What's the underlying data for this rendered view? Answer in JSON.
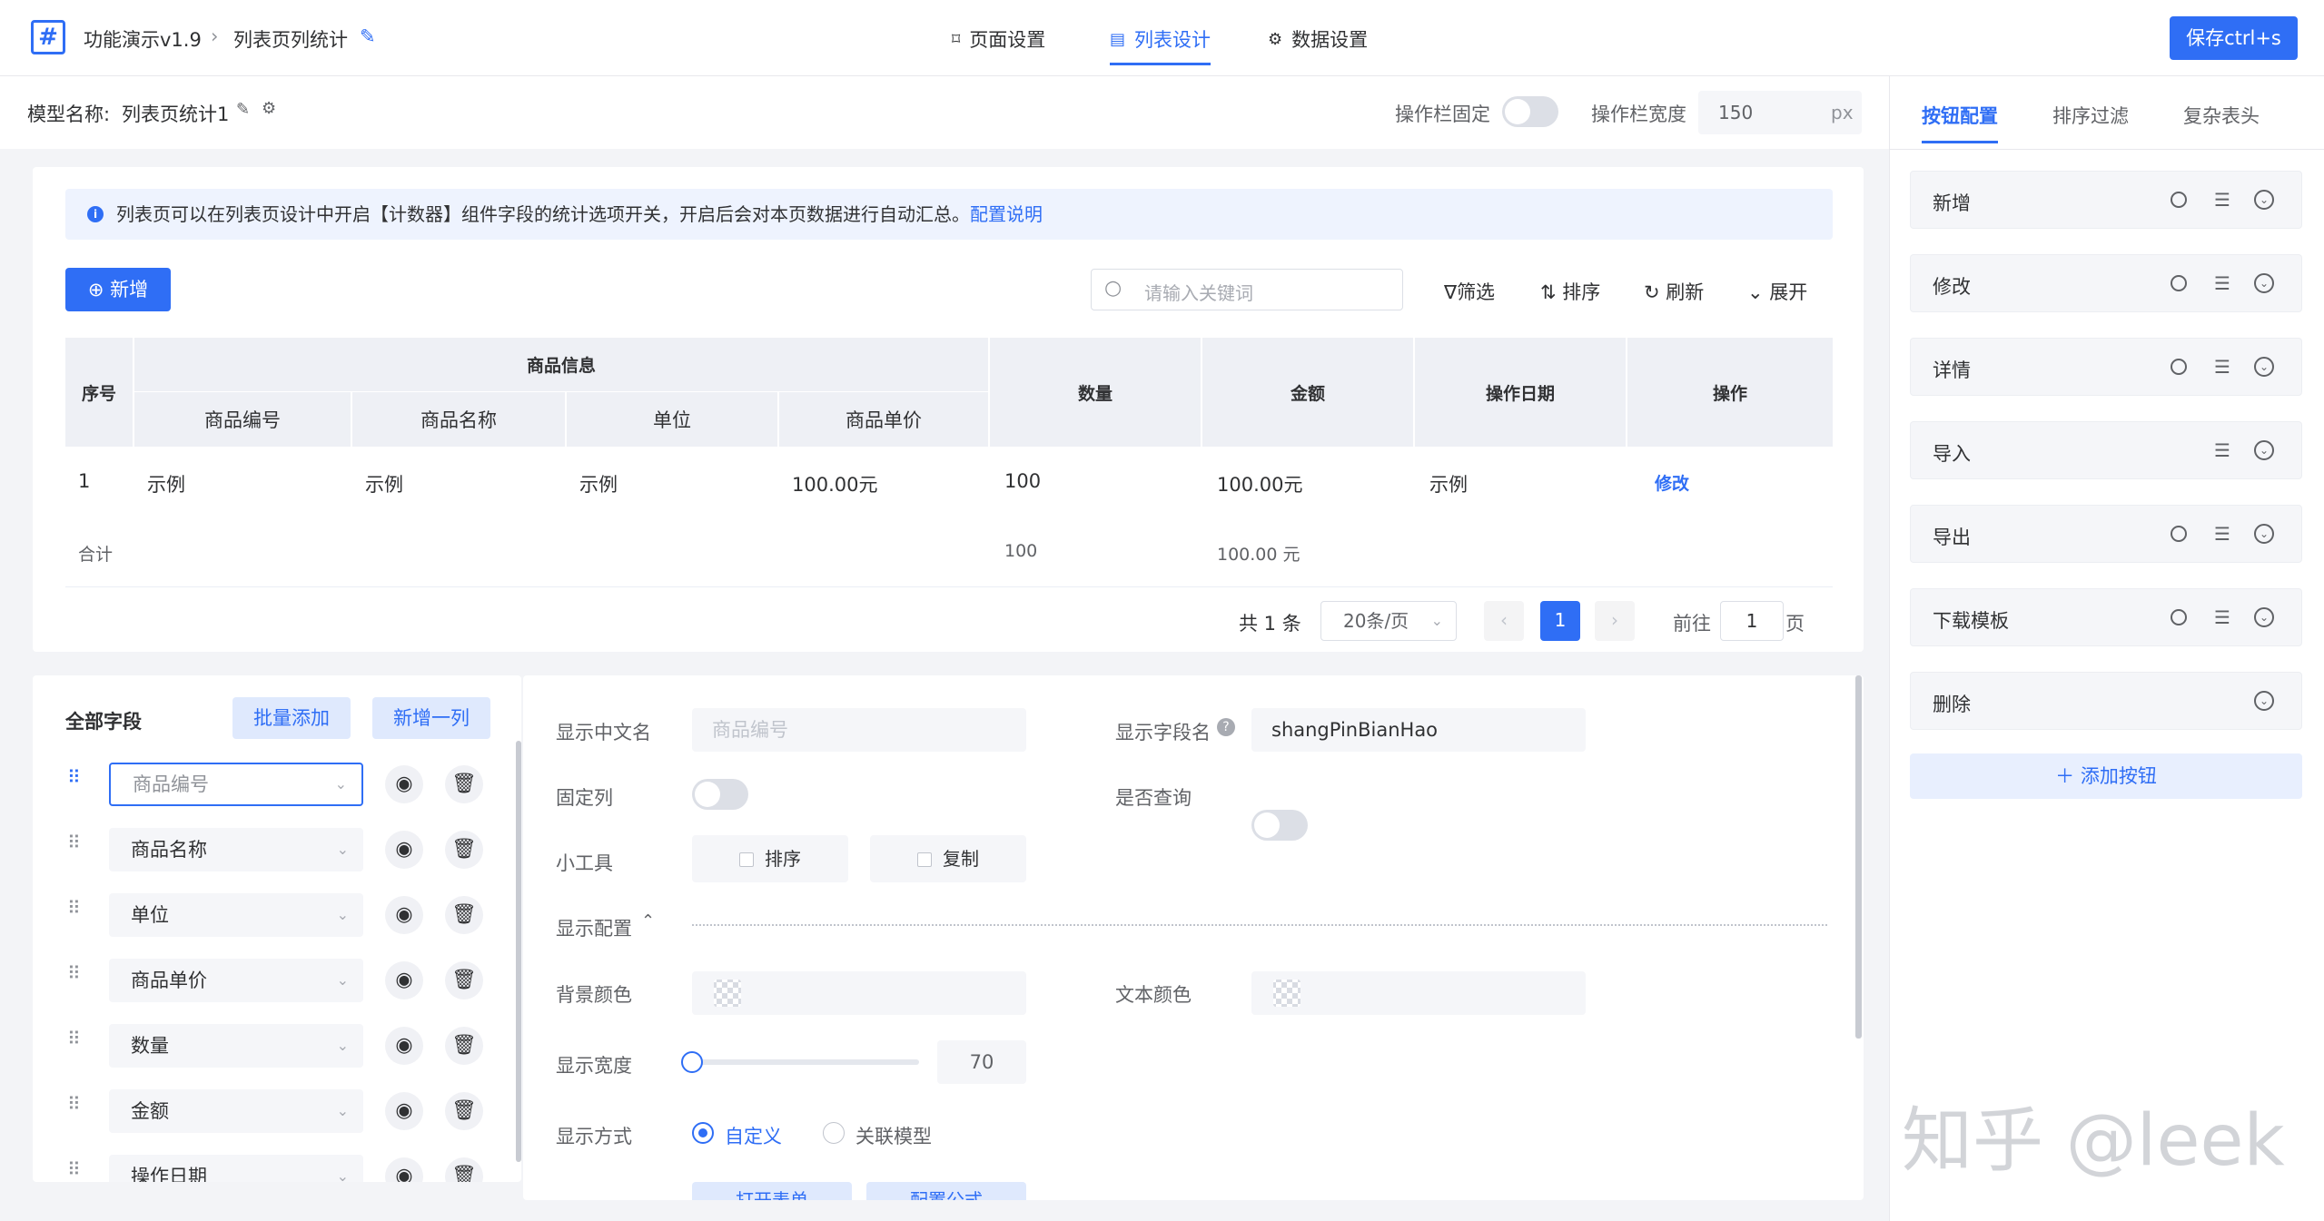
{
  "header": {
    "logo": "#",
    "breadcrumb": [
      "功能演示v1.9",
      "列表页列统计"
    ],
    "tabs": [
      {
        "label": "页面设置",
        "active": false
      },
      {
        "label": "列表设计",
        "active": true
      },
      {
        "label": "数据设置",
        "active": false
      }
    ],
    "save_label": "保存ctrl+s"
  },
  "subheader": {
    "model_label": "模型名称:",
    "model_name": "列表页统计1",
    "fixed_label": "操作栏固定",
    "width_label": "操作栏宽度",
    "width_value": "150",
    "width_unit": "px"
  },
  "notice": {
    "text": "列表页可以在列表页设计中开启【计数器】组件字段的统计选项开关，开启后会对本页数据进行自动汇总。",
    "link": "配置说明"
  },
  "toolbar": {
    "add_label": "新增",
    "search_placeholder": "请输入关键词",
    "filter": "筛选",
    "sort": "排序",
    "refresh": "刷新",
    "expand": "展开"
  },
  "table": {
    "col_seq": "序号",
    "group_label": "商品信息",
    "sub_cols": [
      "商品编号",
      "商品名称",
      "单位",
      "商品单价"
    ],
    "cols": [
      "数量",
      "金额",
      "操作日期",
      "操作"
    ],
    "row": {
      "seq": "1",
      "code": "示例",
      "name": "示例",
      "unit": "示例",
      "price": "100.00元",
      "qty": "100",
      "amount": "100.00元",
      "date": "示例",
      "action": "修改"
    },
    "total": {
      "label": "合计",
      "qty": "100",
      "amount": "100.00 元"
    }
  },
  "pagination": {
    "total": "共 1 条",
    "page_size": "20条/页",
    "current": "1",
    "goto_label": "前往",
    "goto_value": "1",
    "page_unit": "页"
  },
  "fields": {
    "title": "全部字段",
    "batch_add": "批量添加",
    "add_col": "新增一列",
    "items": [
      "商品编号",
      "商品名称",
      "单位",
      "商品单价",
      "数量",
      "金额",
      "操作日期"
    ]
  },
  "config": {
    "cn_name_label": "显示中文名",
    "cn_name_placeholder": "商品编号",
    "field_name_label": "显示字段名",
    "field_name_value": "shangPinBianHao",
    "fixed_col_label": "固定列",
    "query_label": "是否查询",
    "tools_label": "小工具",
    "tool_sort": "排序",
    "tool_copy": "复制",
    "display_cfg_label": "显示配置",
    "bg_color_label": "背景颜色",
    "text_color_label": "文本颜色",
    "width_label": "显示宽度",
    "width_value": "70",
    "width_fraction": 0,
    "mode_label": "显示方式",
    "mode_custom": "自定义",
    "mode_model": "关联模型",
    "btn_open_form": "打开表单",
    "btn_formula": "配置公式"
  },
  "right_panel": {
    "tabs": [
      "按钮配置",
      "排序过滤",
      "复杂表头"
    ],
    "buttons": [
      {
        "label": "新增",
        "gear": true
      },
      {
        "label": "修改",
        "gear": true
      },
      {
        "label": "详情",
        "gear": true
      },
      {
        "label": "导入",
        "gear": false
      },
      {
        "label": "导出",
        "gear": true
      },
      {
        "label": "下载模板",
        "gear": true
      },
      {
        "label": "删除",
        "gear": false,
        "list": false
      }
    ],
    "add_button": "添加按钮"
  },
  "watermark": "知乎 @leek"
}
